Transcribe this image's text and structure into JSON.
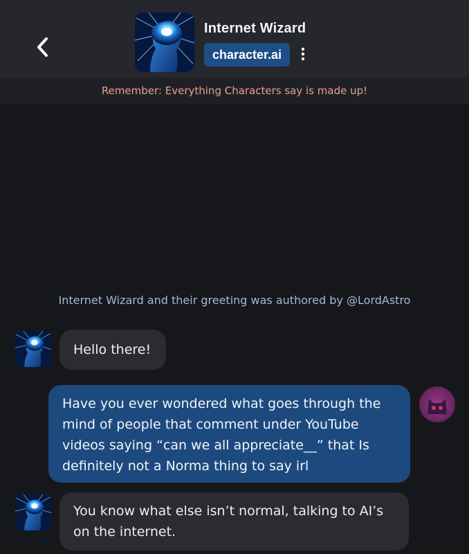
{
  "header": {
    "character_name": "Internet Wizard",
    "platform_badge": "character.ai",
    "back_icon": "chevron-left-icon",
    "more_icon": "vertical-dots-icon"
  },
  "disclaimer": "Remember: Everything Characters say is made up!",
  "attribution": "Internet Wizard  and their greeting was authored by @LordAstro",
  "messages": [
    {
      "sender": "character",
      "text": "Hello there!"
    },
    {
      "sender": "user",
      "text": "Have you ever wondered what goes through the mind of people that comment under YouTube videos saying “can we all appreciate__” that Is definitely not a Norma thing to say irl"
    },
    {
      "sender": "character",
      "text": "You know what else isn’t normal, talking to AI’s on the internet."
    }
  ],
  "colors": {
    "background": "#16171b",
    "header": "#26272c",
    "badge": "#1e4e86",
    "user_bubble": "#1d4a7e",
    "character_bubble": "#2b2c31",
    "disclaimer_text": "#e7a08e",
    "attribution_text": "#a3b8d7"
  }
}
